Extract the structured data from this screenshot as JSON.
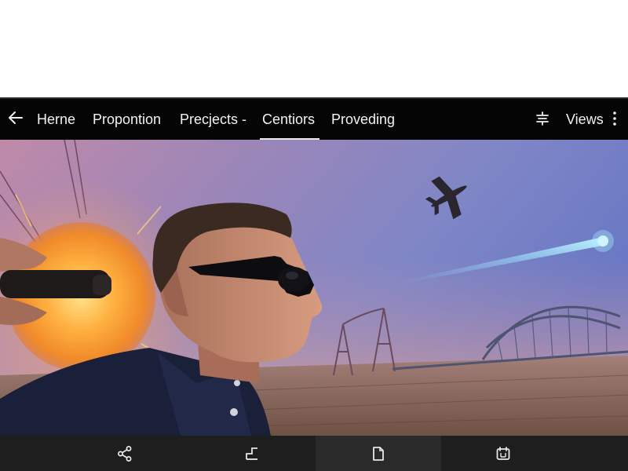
{
  "navbar": {
    "back_icon": "arrow-left-icon",
    "tabs": [
      {
        "label": "Herne",
        "active": false
      },
      {
        "label": "Propontion",
        "active": false
      },
      {
        "label": "Precjects -",
        "active": false
      },
      {
        "label": "Centiors",
        "active": true
      },
      {
        "label": "Proveding",
        "active": false
      }
    ],
    "filter_icon": "filter-icon",
    "views_label": "Views",
    "more_icon": "more-vertical-icon"
  },
  "content": {
    "image_subject": "man in sunglasses, glowing sun, airplane, light beam, bridge"
  },
  "bottom_bar": {
    "buttons": [
      {
        "icon": "share-icon"
      },
      {
        "icon": "crop-icon"
      },
      {
        "icon": "document-icon"
      },
      {
        "icon": "calendar-icon"
      }
    ]
  },
  "colors": {
    "navbar_bg": "#050505",
    "bottom_bar_bg": "#1e1e1e",
    "text": "#f2f2f2"
  }
}
